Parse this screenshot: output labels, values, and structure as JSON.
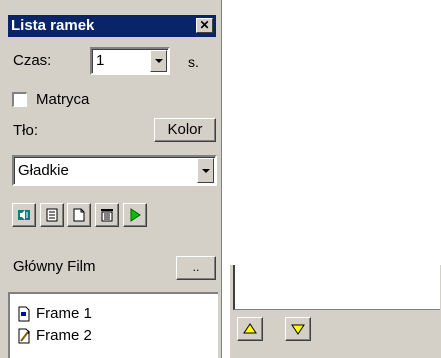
{
  "panel": {
    "title": "Lista ramek",
    "close_glyph": "✕",
    "time_label": "Czas:",
    "time_value": "1",
    "time_unit": "s.",
    "matrix_label": "Matryca",
    "matrix_checked": false,
    "background_label": "Tło:",
    "color_button": "Kolor",
    "background_type": "Gładkie",
    "toolbar": [
      {
        "icon": "speaker-icon"
      },
      {
        "icon": "properties-icon"
      },
      {
        "icon": "new-frame-icon"
      },
      {
        "icon": "delete-icon"
      },
      {
        "icon": "play-icon"
      }
    ],
    "main_film_label": "Główny Film",
    "browse_button": "..",
    "frames": [
      {
        "label": "Frame 1",
        "icon": "frame-document-icon"
      },
      {
        "label": "Frame 2",
        "icon": "frame-edit-icon"
      }
    ]
  },
  "nav": {
    "up_icon": "arrow-up-icon",
    "down_icon": "arrow-down-icon",
    "arrow_color": "#ffff00"
  }
}
